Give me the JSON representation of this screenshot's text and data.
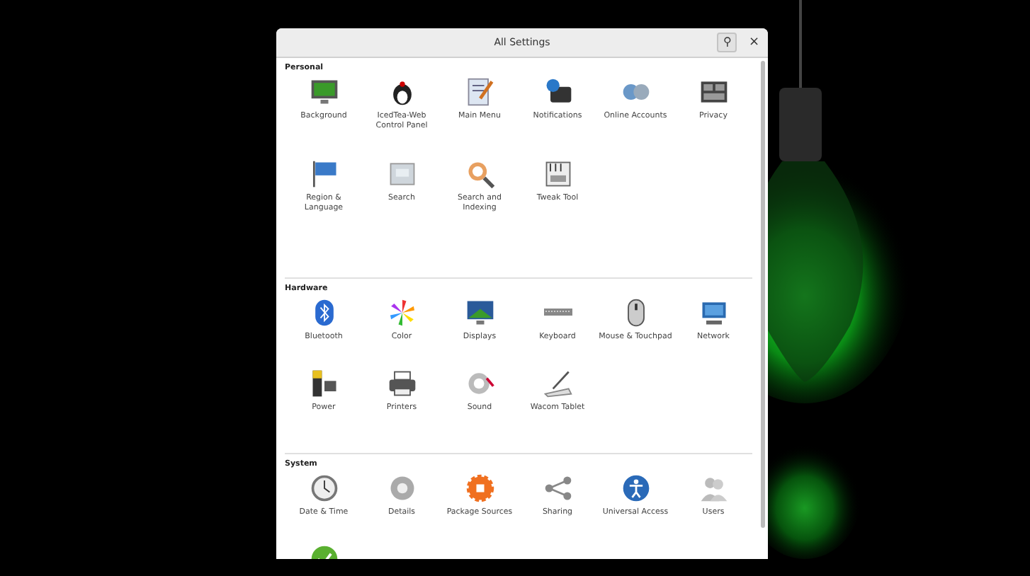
{
  "window": {
    "title": "All Settings",
    "search_button": "⚲",
    "close_button": "×"
  },
  "sections": [
    {
      "title": "Personal",
      "items": [
        {
          "label": "Background"
        },
        {
          "label": "IcedTea-Web Control Panel"
        },
        {
          "label": "Main Menu"
        },
        {
          "label": "Notifications"
        },
        {
          "label": "Online Accounts"
        },
        {
          "label": "Privacy"
        },
        {
          "label": "Region & Language"
        },
        {
          "label": "Search"
        },
        {
          "label": "Search and Indexing"
        },
        {
          "label": "Tweak Tool"
        }
      ]
    },
    {
      "title": "Hardware",
      "items": [
        {
          "label": "Bluetooth"
        },
        {
          "label": "Color"
        },
        {
          "label": "Displays"
        },
        {
          "label": "Keyboard"
        },
        {
          "label": "Mouse & Touchpad"
        },
        {
          "label": "Network"
        },
        {
          "label": "Power"
        },
        {
          "label": "Printers"
        },
        {
          "label": "Sound"
        },
        {
          "label": "Wacom Tablet"
        }
      ]
    },
    {
      "title": "System",
      "clipped_row_below": true,
      "items": [
        {
          "label": "Date & Time"
        },
        {
          "label": "Details"
        },
        {
          "label": "Package Sources"
        },
        {
          "label": "Sharing"
        },
        {
          "label": "Universal Access"
        },
        {
          "label": "Users"
        }
      ]
    }
  ]
}
